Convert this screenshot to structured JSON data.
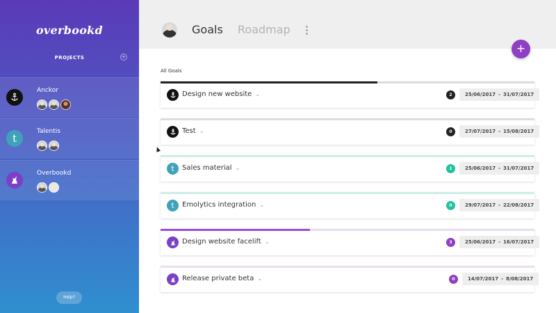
{
  "app": {
    "logo_text": "overbookd",
    "projects_heading": "PROJECTS",
    "add_project_glyph": "+",
    "help_label": "Help?"
  },
  "colors": {
    "anckor": "#111111",
    "talentis": "#3fa2b8",
    "overbookd": "#7b3fc8",
    "accent_purple": "#8e3fc4",
    "teal": "#21c2a0"
  },
  "projects": [
    {
      "name": "Anckor",
      "icon": "anchor-icon",
      "members": 3
    },
    {
      "name": "Talentis",
      "icon": "letter-t-icon",
      "glyph": "t",
      "members": 2
    },
    {
      "name": "Overbookd",
      "icon": "unicorn-icon",
      "members": 2
    }
  ],
  "header": {
    "tabs": [
      {
        "label": "Goals",
        "active": true
      },
      {
        "label": "Roadmap",
        "active": false
      }
    ],
    "more_icon": "more-vertical-icon"
  },
  "fab_glyph": "+",
  "main": {
    "section_label": "All Goals"
  },
  "goals": [
    {
      "title": "Design new website",
      "project": "anckor",
      "count": "2",
      "start": "25/06/2017",
      "end": "31/07/2017",
      "progress": 0.58
    },
    {
      "title": "Test",
      "project": "anckor",
      "count": "0",
      "start": "27/07/2017",
      "end": "15/08/2017",
      "progress": 0
    },
    {
      "title": "Sales material",
      "project": "talentis",
      "count": "1",
      "start": "25/06/2017",
      "end": "31/07/2017",
      "progress": 0
    },
    {
      "title": "Emolytics integration",
      "project": "talentis",
      "count": "0",
      "start": "29/07/2017",
      "end": "22/08/2017",
      "progress": 0
    },
    {
      "title": "Design website facelift",
      "project": "overbookd",
      "count": "3",
      "start": "25/06/2017",
      "end": "16/07/2017",
      "progress": 0.4
    },
    {
      "title": "Release private beta",
      "project": "overbookd",
      "count": "0",
      "start": "14/07/2017",
      "end": "8/08/2017",
      "progress": 0
    }
  ],
  "date_separator": "-"
}
